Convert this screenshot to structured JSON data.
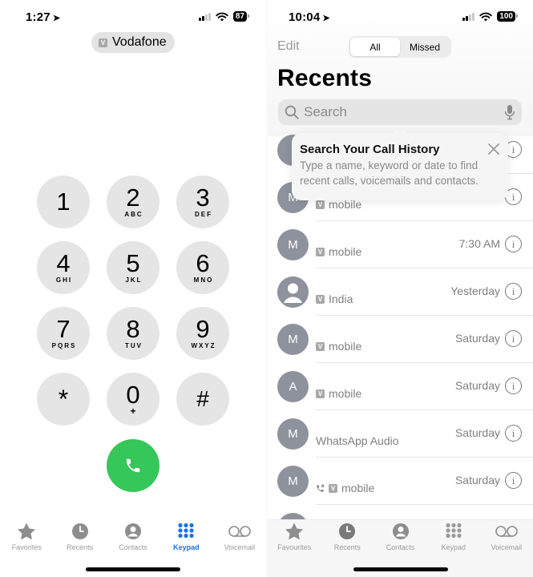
{
  "left_screen": {
    "status_bar": {
      "time": "1:27",
      "battery": "87"
    },
    "carrier": {
      "badge": "V",
      "name": "Vodafone"
    },
    "keypad": [
      {
        "digit": "1",
        "letters": ""
      },
      {
        "digit": "2",
        "letters": "ABC"
      },
      {
        "digit": "3",
        "letters": "DEF"
      },
      {
        "digit": "4",
        "letters": "GHI"
      },
      {
        "digit": "5",
        "letters": "JKL"
      },
      {
        "digit": "6",
        "letters": "MNO"
      },
      {
        "digit": "7",
        "letters": "PQRS"
      },
      {
        "digit": "8",
        "letters": "TUV"
      },
      {
        "digit": "9",
        "letters": "WXYZ"
      },
      {
        "digit": "*",
        "letters": ""
      },
      {
        "digit": "0",
        "letters": "+"
      },
      {
        "digit": "#",
        "letters": ""
      }
    ],
    "call_button_color": "#35c759",
    "tabs": [
      {
        "label": "Favorites",
        "icon": "star-icon"
      },
      {
        "label": "Recents",
        "icon": "clock-icon"
      },
      {
        "label": "Contacts",
        "icon": "contact-icon"
      },
      {
        "label": "Keypad",
        "icon": "keypad-icon",
        "active": true
      },
      {
        "label": "Voicemail",
        "icon": "voicemail-icon"
      }
    ],
    "accent_color": "#1a73e8"
  },
  "right_screen": {
    "status_bar": {
      "time": "10:04",
      "battery": "100"
    },
    "edit_label": "Edit",
    "segments": [
      {
        "label": "All",
        "active": true
      },
      {
        "label": "Missed"
      }
    ],
    "title": "Recents",
    "search": {
      "placeholder": "Search"
    },
    "tooltip": {
      "title": "Search Your Call History",
      "body": "Type a name, keyword or date to find recent calls, voicemails and contacts."
    },
    "calls": [
      {
        "initial": "",
        "badge": "",
        "type": "",
        "when": ""
      },
      {
        "initial": "M",
        "badge": "V",
        "type": "mobile",
        "when": ""
      },
      {
        "initial": "M",
        "badge": "V",
        "type": "mobile",
        "when": "7:30 AM"
      },
      {
        "initial": "",
        "avatar": "person",
        "badge": "V",
        "type": "India",
        "when": "Yesterday"
      },
      {
        "initial": "M",
        "badge": "V",
        "type": "mobile",
        "when": "Saturday"
      },
      {
        "initial": "A",
        "badge": "V",
        "type": "mobile",
        "when": "Saturday"
      },
      {
        "initial": "M",
        "badge": "",
        "type": "WhatsApp Audio",
        "when": "Saturday"
      },
      {
        "initial": "M",
        "badge": "V",
        "type": "mobile",
        "outgoing": true,
        "when": "Saturday"
      }
    ],
    "tabs": [
      {
        "label": "Favourites",
        "icon": "star-icon"
      },
      {
        "label": "Recents",
        "icon": "clock-icon",
        "active": true
      },
      {
        "label": "Contacts",
        "icon": "contact-icon"
      },
      {
        "label": "Keypad",
        "icon": "keypad-icon"
      },
      {
        "label": "Voicemail",
        "icon": "voicemail-icon"
      }
    ]
  }
}
